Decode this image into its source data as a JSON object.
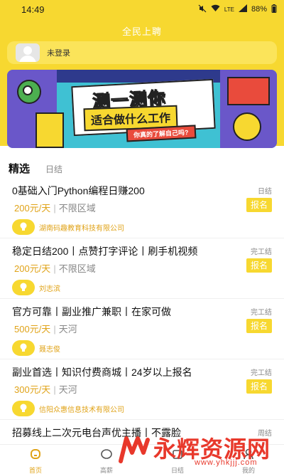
{
  "status_bar": {
    "time": "14:49",
    "battery": "88%",
    "signal": "LTE"
  },
  "header": {
    "title": "全民上聘"
  },
  "login": {
    "label": "未登录"
  },
  "banner": {
    "main": "测一测你",
    "sub": "适合做什么工作",
    "tag": "你真的了解自己吗?"
  },
  "tabs": [
    {
      "label": "精选"
    },
    {
      "label": "日结"
    }
  ],
  "jobs": [
    {
      "title": "0基础入门Python编程日赚200",
      "type": "日结",
      "salary": "200元/天",
      "area": "不限区域",
      "apply": "报名",
      "company": "湖南码趣教育科技有限公司"
    },
    {
      "title": "稳定日结200丨点赞打字评论丨刷手机视频",
      "type": "完工结",
      "salary": "200元/天",
      "area": "不限区域",
      "apply": "报名",
      "company": "刘志滨"
    },
    {
      "title": "官方可靠丨副业推广兼职丨在家可做",
      "type": "完工结",
      "salary": "500元/天",
      "area": "天河",
      "apply": "报名",
      "company": "聂志俊"
    },
    {
      "title": "副业首选丨知识付费商城丨24岁以上报名",
      "type": "完工结",
      "salary": "300元/天",
      "area": "天河",
      "apply": "报名",
      "company": "信阳众惠信息技术有限公司"
    },
    {
      "title": "招募线上二次元电台声优主播丨不露脸",
      "type": "周结"
    }
  ],
  "bottom_nav": [
    {
      "label": "首页",
      "icon": "home-icon"
    },
    {
      "label": "高薪",
      "icon": "money-icon"
    },
    {
      "label": "日结",
      "icon": "calendar-icon"
    },
    {
      "label": "我的",
      "icon": "user-icon"
    }
  ],
  "watermark": {
    "text": "永辉资源网",
    "url": "www.yhkjjj.com"
  },
  "colors": {
    "accent": "#f7d830",
    "salary": "#e0a318",
    "watermark": "#e8382b"
  }
}
